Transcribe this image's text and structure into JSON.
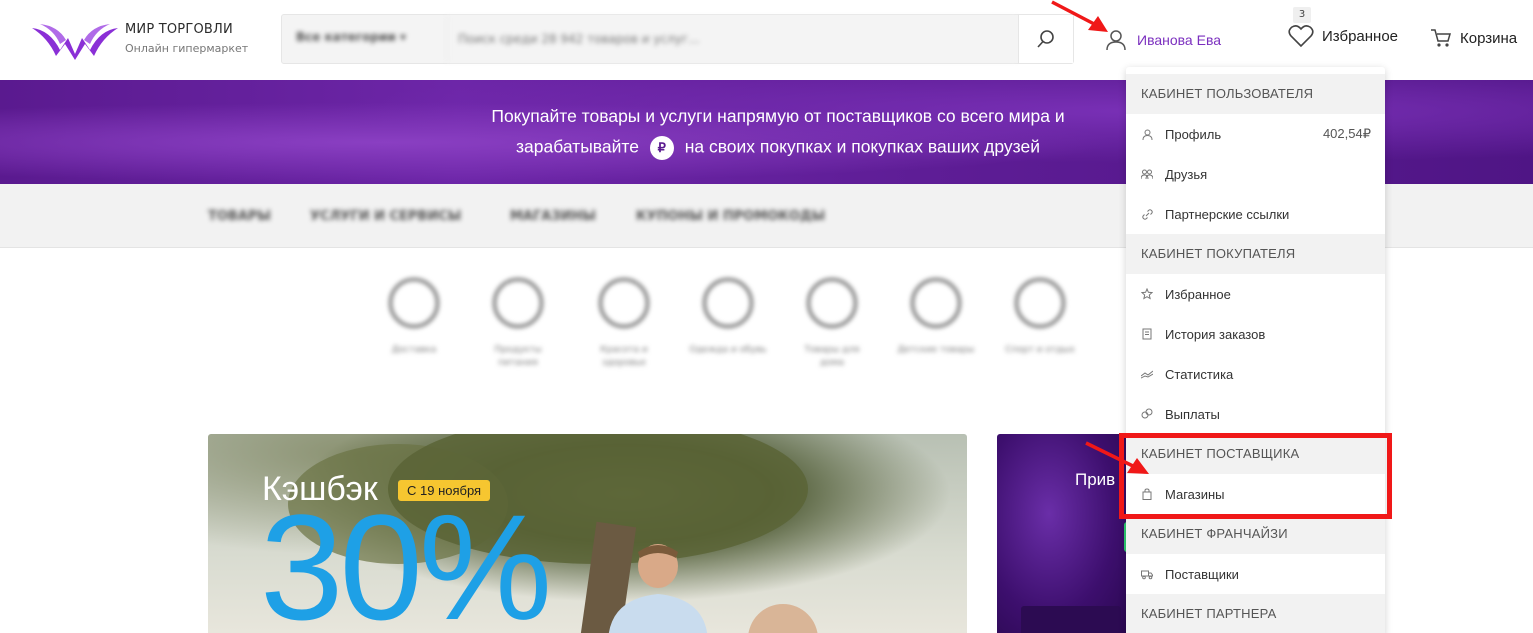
{
  "header": {
    "logo_title": "МИР ТОРГОВЛИ",
    "logo_subtitle": "Онлайн гипермаркет",
    "search_category": "Все категории",
    "search_placeholder": "Поиск среди 28 942 товаров и услуг...",
    "user_name": "Иванова Ева",
    "favorites_label": "Избранное",
    "favorites_count": "3",
    "cart_label": "Корзина"
  },
  "banner": {
    "line1": "Покупайте товары и услуги напрямую от поставщиков со всего мира и",
    "line2_before": "зарабатывайте",
    "currency_symbol": "₽",
    "line2_after": "на своих покупках и покупках ваших друзей"
  },
  "category_nav": [
    "ТОВАРЫ",
    "УСЛУГИ И СЕРВИСЫ",
    "МАГАЗИНЫ",
    "КУПОНЫ И ПРОМОКОДЫ"
  ],
  "icons_row": [
    {
      "label": "Доставка",
      "icon": "delivery-icon"
    },
    {
      "label": "Продукты питания",
      "icon": "food-icon"
    },
    {
      "label": "Красота и здоровье",
      "icon": "beauty-icon"
    },
    {
      "label": "Одежда и обувь",
      "icon": "clothes-icon"
    },
    {
      "label": "Товары для дома",
      "icon": "home-icon"
    },
    {
      "label": "Детские товары",
      "icon": "kids-icon"
    },
    {
      "label": "Спорт и отдых",
      "icon": "sport-icon"
    }
  ],
  "promo": {
    "title": "Кэшбэк",
    "tag": "С 19 ноября",
    "big_value": "30%"
  },
  "side_card": {
    "text": "Прив"
  },
  "dropdown": {
    "sections": [
      {
        "title": "КАБИНЕТ ПОЛЬЗОВАТЕЛЯ",
        "items": [
          {
            "label": "Профиль",
            "icon": "user-icon",
            "amount": "402,54₽"
          },
          {
            "label": "Друзья",
            "icon": "friends-icon"
          },
          {
            "label": "Партнерские ссылки",
            "icon": "link-icon"
          }
        ]
      },
      {
        "title": "КАБИНЕТ ПОКУПАТЕЛЯ",
        "items": [
          {
            "label": "Избранное",
            "icon": "star-icon"
          },
          {
            "label": "История заказов",
            "icon": "history-icon"
          },
          {
            "label": "Статистика",
            "icon": "chart-icon"
          },
          {
            "label": "Выплаты",
            "icon": "payouts-icon"
          }
        ]
      },
      {
        "title": "КАБИНЕТ ПОСТАВЩИКА",
        "items": [
          {
            "label": "Магазины",
            "icon": "shop-bag-icon"
          }
        ]
      },
      {
        "title": "КАБИНЕТ ФРАНЧАЙЗИ",
        "items": [
          {
            "label": "Поставщики",
            "icon": "suppliers-icon"
          }
        ]
      },
      {
        "title": "КАБИНЕТ ПАРТНЕРА",
        "items": []
      }
    ]
  },
  "colors": {
    "accent_purple": "#7b2fbf",
    "banner_purple": "#5a1a8f",
    "annotation_red": "#f01818",
    "promo_blue": "#1ea0e6",
    "tag_yellow": "#f6c630"
  }
}
